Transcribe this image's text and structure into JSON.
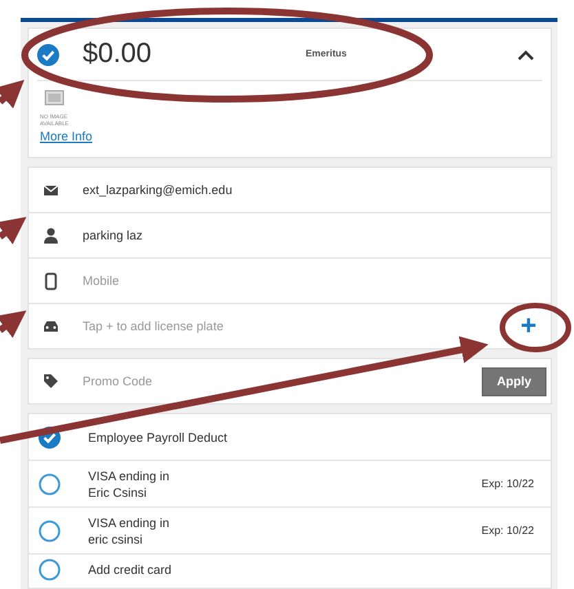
{
  "permit": {
    "selected": true,
    "price": "$0.00",
    "type": "Emeritus",
    "expanded": true,
    "image_caption": [
      "NO IMAGE",
      "AVAILABLE"
    ],
    "more_info": "More Info"
  },
  "contact": [
    {
      "kind": "email",
      "value": "ext_lazparking@emich.edu"
    },
    {
      "kind": "person",
      "value": "parking laz"
    },
    {
      "kind": "mobile",
      "placeholder": "Mobile"
    },
    {
      "kind": "car",
      "placeholder": "Tap + to add license plate",
      "action": "+"
    }
  ],
  "promo": {
    "placeholder": "Promo Code",
    "button": "Apply"
  },
  "payments": [
    {
      "selected": true,
      "title": "Employee Payroll Deduct"
    },
    {
      "selected": false,
      "title": "VISA ending in",
      "subtitle": "Eric Csinsi",
      "expiry": "Exp: 10/22"
    },
    {
      "selected": false,
      "title": "VISA ending in",
      "subtitle": "eric csinsi",
      "expiry": "Exp: 10/22"
    },
    {
      "selected": false,
      "title": "Add credit card"
    }
  ]
}
